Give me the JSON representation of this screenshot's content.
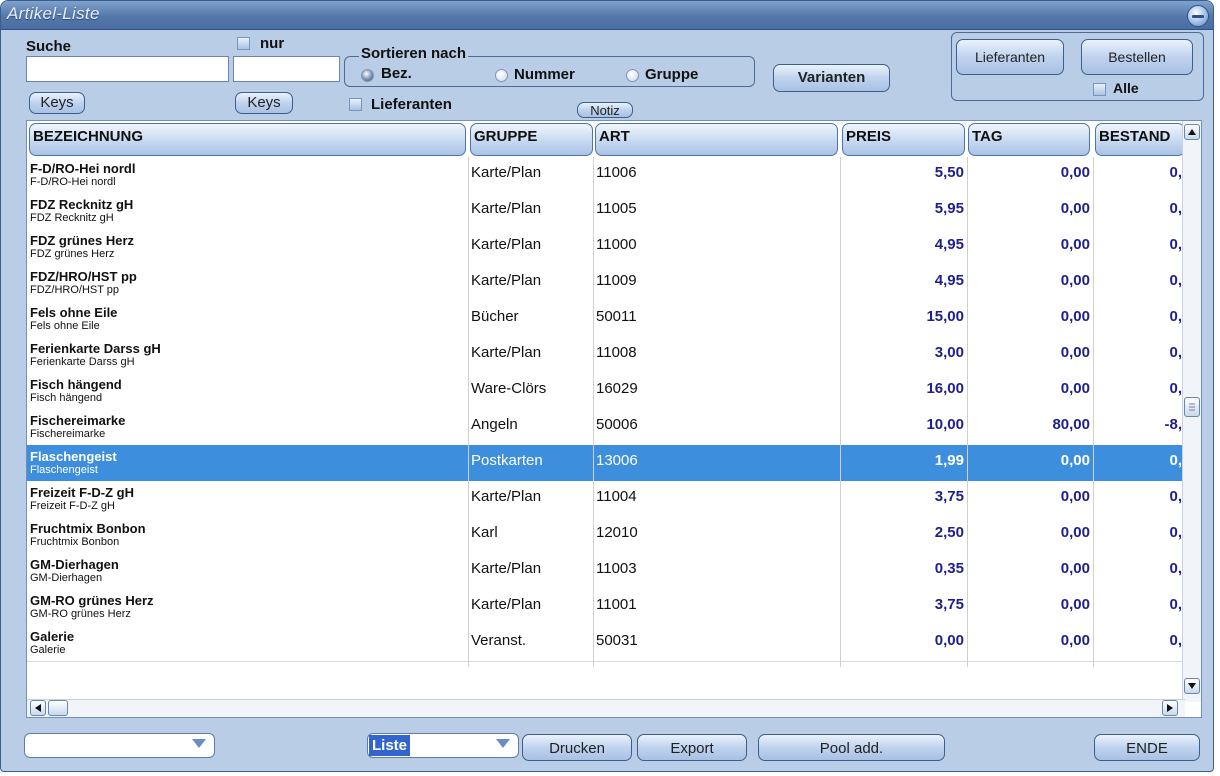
{
  "window": {
    "title": "Artikel-Liste"
  },
  "search": {
    "label": "Suche",
    "value1": "",
    "value2": "",
    "nur_label": "nur",
    "keys1": "Keys",
    "keys2": "Keys",
    "lieferanten_label": "Lieferanten"
  },
  "sort": {
    "title": "Sortieren nach",
    "options": [
      "Bez.",
      "Nummer",
      "Gruppe"
    ],
    "selected": "Bez."
  },
  "toolbar": {
    "varianten": "Varianten",
    "notiz": "Notiz",
    "lieferanten": "Lieferanten",
    "bestellen": "Bestellen",
    "alle_label": "Alle"
  },
  "grid": {
    "columns": [
      "BEZEICHNUNG",
      "GRUPPE",
      "ART",
      "PREIS",
      "TAG",
      "BESTAND"
    ],
    "rows": [
      {
        "name": "F-D/RO-Hei nordl",
        "sub": "F-D/RO-Hei nordl",
        "gruppe": "Karte/Plan",
        "art": "11006",
        "preis": "5,50",
        "tag": "0,00",
        "bestand": "0,"
      },
      {
        "name": "FDZ Recknitz gH",
        "sub": "FDZ Recknitz gH",
        "gruppe": "Karte/Plan",
        "art": "11005",
        "preis": "5,95",
        "tag": "0,00",
        "bestand": "0,"
      },
      {
        "name": "FDZ grünes Herz",
        "sub": "FDZ grünes Herz",
        "gruppe": "Karte/Plan",
        "art": "11000",
        "preis": "4,95",
        "tag": "0,00",
        "bestand": "0,"
      },
      {
        "name": "FDZ/HRO/HST pp",
        "sub": "FDZ/HRO/HST pp",
        "gruppe": "Karte/Plan",
        "art": "11009",
        "preis": "4,95",
        "tag": "0,00",
        "bestand": "0,"
      },
      {
        "name": "Fels ohne Eile",
        "sub": "Fels ohne Eile",
        "gruppe": "Bücher",
        "art": "50011",
        "preis": "15,00",
        "tag": "0,00",
        "bestand": "0,"
      },
      {
        "name": "Ferienkarte Darss gH",
        "sub": "Ferienkarte Darss gH",
        "gruppe": "Karte/Plan",
        "art": "11008",
        "preis": "3,00",
        "tag": "0,00",
        "bestand": "0,"
      },
      {
        "name": "Fisch hängend",
        "sub": "Fisch hängend",
        "gruppe": "Ware-Clörs",
        "art": "16029",
        "preis": "16,00",
        "tag": "0,00",
        "bestand": "0,"
      },
      {
        "name": "Fischereimarke",
        "sub": "Fischereimarke",
        "gruppe": "Angeln",
        "art": "50006",
        "preis": "10,00",
        "tag": "80,00",
        "bestand": "-8,"
      },
      {
        "name": "Flaschengeist",
        "sub": "Flaschengeist",
        "gruppe": "Postkarten",
        "art": "13006",
        "preis": "1,99",
        "tag": "0,00",
        "bestand": "0,"
      },
      {
        "name": "Freizeit F-D-Z gH",
        "sub": "Freizeit F-D-Z gH",
        "gruppe": "Karte/Plan",
        "art": "11004",
        "preis": "3,75",
        "tag": "0,00",
        "bestand": "0,"
      },
      {
        "name": "Fruchtmix Bonbon",
        "sub": "Fruchtmix Bonbon",
        "gruppe": "Karl",
        "art": "12010",
        "preis": "2,50",
        "tag": "0,00",
        "bestand": "0,"
      },
      {
        "name": "GM-Dierhagen",
        "sub": "GM-Dierhagen",
        "gruppe": "Karte/Plan",
        "art": "11003",
        "preis": "0,35",
        "tag": "0,00",
        "bestand": "0,"
      },
      {
        "name": "GM-RO grünes Herz",
        "sub": "GM-RO grünes Herz",
        "gruppe": "Karte/Plan",
        "art": "11001",
        "preis": "3,75",
        "tag": "0,00",
        "bestand": "0,"
      },
      {
        "name": "Galerie",
        "sub": "Galerie",
        "gruppe": "Veranst.",
        "art": "50031",
        "preis": "0,00",
        "tag": "0,00",
        "bestand": "0,"
      }
    ],
    "selected_row": "Flaschengeist"
  },
  "footer": {
    "combo1_value": "",
    "combo2_value": "Liste",
    "drucken": "Drucken",
    "export": "Export",
    "pool_add": "Pool add.",
    "ende": "ENDE"
  },
  "colors": {
    "selection": "#3d8fdd",
    "window_bg": "#b9cde6",
    "title_bar": "#5478ab",
    "number_text": "#1e1e8e"
  }
}
